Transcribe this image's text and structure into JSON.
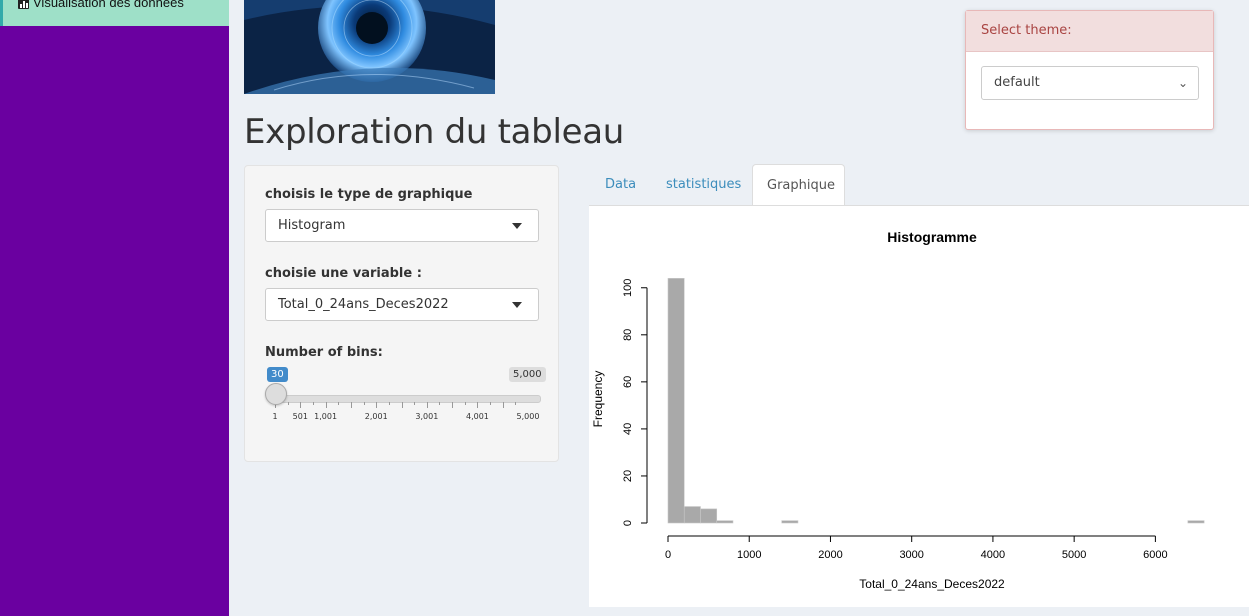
{
  "sidebar": {
    "active_item": {
      "label": "Visualisation des données",
      "icon": "bar-chart-icon"
    }
  },
  "header_image": {
    "description_icon": "eye-image"
  },
  "page_title": "Exploration du tableau",
  "theme_panel": {
    "title": "Select theme:",
    "selected": "default"
  },
  "controls": {
    "chart_type_label": "choisis le type de graphique",
    "chart_type_value": "Histogram",
    "variable_label": "choisie une variable :",
    "variable_value": "Total_0_24ans_Deces2022",
    "bins_label": "Number of bins:",
    "bins_value": "30",
    "bins_value_fraction": 0.0058,
    "bins_max_label": "5,000",
    "bins_ticks": [
      "1",
      "501",
      "1,001",
      "2,001",
      "3,001",
      "4,001",
      "5,000"
    ]
  },
  "tabs": [
    {
      "label": "Data",
      "active": false
    },
    {
      "label": "statistiques",
      "active": false
    },
    {
      "label": "Graphique",
      "active": true
    }
  ],
  "colors": {
    "sidebar": "#6a00a0",
    "active_item": "#9ee0c8",
    "accent": "#3c8dbc",
    "bar": "#a9a9a9"
  },
  "chart_data": {
    "type": "bar",
    "title": "Histogramme",
    "xlabel": "Total_0_24ans_Deces2022",
    "ylabel": "Frequency",
    "xlim": [
      0,
      6500
    ],
    "ylim": [
      0,
      105
    ],
    "xticks": [
      0,
      1000,
      2000,
      3000,
      4000,
      5000,
      6000
    ],
    "yticks": [
      0,
      20,
      40,
      60,
      80,
      100
    ],
    "bin_width": 200,
    "bins": [
      {
        "x0": 0,
        "x1": 200,
        "count": 104
      },
      {
        "x0": 200,
        "x1": 400,
        "count": 7
      },
      {
        "x0": 400,
        "x1": 600,
        "count": 6
      },
      {
        "x0": 600,
        "x1": 800,
        "count": 1
      },
      {
        "x0": 800,
        "x1": 1000,
        "count": 0
      },
      {
        "x0": 1000,
        "x1": 1200,
        "count": 0
      },
      {
        "x0": 1200,
        "x1": 1400,
        "count": 0
      },
      {
        "x0": 1400,
        "x1": 1600,
        "count": 1
      },
      {
        "x0": 1600,
        "x1": 1800,
        "count": 0
      },
      {
        "x0": 1800,
        "x1": 2000,
        "count": 0
      },
      {
        "x0": 2000,
        "x1": 2200,
        "count": 0
      },
      {
        "x0": 2200,
        "x1": 2400,
        "count": 0
      },
      {
        "x0": 2400,
        "x1": 2600,
        "count": 0
      },
      {
        "x0": 2600,
        "x1": 2800,
        "count": 0
      },
      {
        "x0": 2800,
        "x1": 3000,
        "count": 0
      },
      {
        "x0": 3000,
        "x1": 3200,
        "count": 0
      },
      {
        "x0": 3200,
        "x1": 3400,
        "count": 0
      },
      {
        "x0": 3400,
        "x1": 3600,
        "count": 0
      },
      {
        "x0": 3600,
        "x1": 3800,
        "count": 0
      },
      {
        "x0": 3800,
        "x1": 4000,
        "count": 0
      },
      {
        "x0": 4000,
        "x1": 4200,
        "count": 0
      },
      {
        "x0": 4200,
        "x1": 4400,
        "count": 0
      },
      {
        "x0": 4400,
        "x1": 4600,
        "count": 0
      },
      {
        "x0": 4600,
        "x1": 4800,
        "count": 0
      },
      {
        "x0": 4800,
        "x1": 5000,
        "count": 0
      },
      {
        "x0": 5000,
        "x1": 5200,
        "count": 0
      },
      {
        "x0": 5200,
        "x1": 5400,
        "count": 0
      },
      {
        "x0": 5400,
        "x1": 5600,
        "count": 0
      },
      {
        "x0": 5600,
        "x1": 5800,
        "count": 0
      },
      {
        "x0": 5800,
        "x1": 6000,
        "count": 0
      },
      {
        "x0": 6000,
        "x1": 6200,
        "count": 0
      },
      {
        "x0": 6200,
        "x1": 6400,
        "count": 0
      },
      {
        "x0": 6400,
        "x1": 6600,
        "count": 1
      }
    ]
  }
}
